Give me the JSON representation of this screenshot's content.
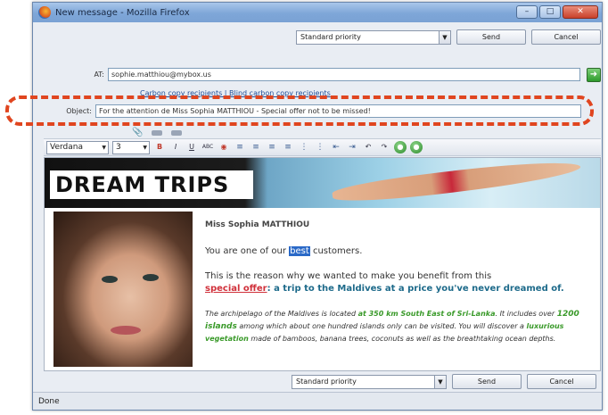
{
  "window": {
    "title": "New message - Mozilla Firefox",
    "controls": [
      "–",
      "□",
      "✕"
    ]
  },
  "toolbar": {
    "priority": "Standard priority",
    "send": "Send",
    "cancel": "Cancel"
  },
  "fields": {
    "to_label": "AT:",
    "to_value": "sophie.matthiou@mybox.us",
    "cc_links": "Carbon copy recipients | Blind carbon copy recipients",
    "subject_label": "Object:",
    "subject_value": "For the attention de Miss Sophia MATTHIOU - Special offer not to be missed!"
  },
  "format": {
    "font": "Verdana",
    "size": "3"
  },
  "email": {
    "banner_title": "DREAM TRIPS",
    "greeting": "Miss Sophia MATTHIOU",
    "line1_before": "You are one of our ",
    "line1_highlight": "best",
    "line1_after": " customers.",
    "line2_start": "This is the reason why we wanted to make you benefit from this",
    "special_offer": "special offer",
    "line2_rest": ": a trip to the Maldives at a price you've never dreamed of.",
    "p3_a": "The archipelago of the Maldives is located ",
    "p3_distance": "at 350 km South East of Sri-Lanka",
    "p3_b": ". It includes over ",
    "p3_islands": "1200 islands",
    "p3_c": " among which about one hundred islands only can be visited. You will discover a ",
    "p3_vegetation": "luxurious vegetation",
    "p3_d": " made of bamboos, banana trees, coconuts as well as the breathtaking ocean depths."
  },
  "status": {
    "text": "Done"
  },
  "colors": {
    "highlight_border": "#e0451f",
    "link_blue": "#1f4f9a",
    "offer_red": "#d0303a"
  }
}
